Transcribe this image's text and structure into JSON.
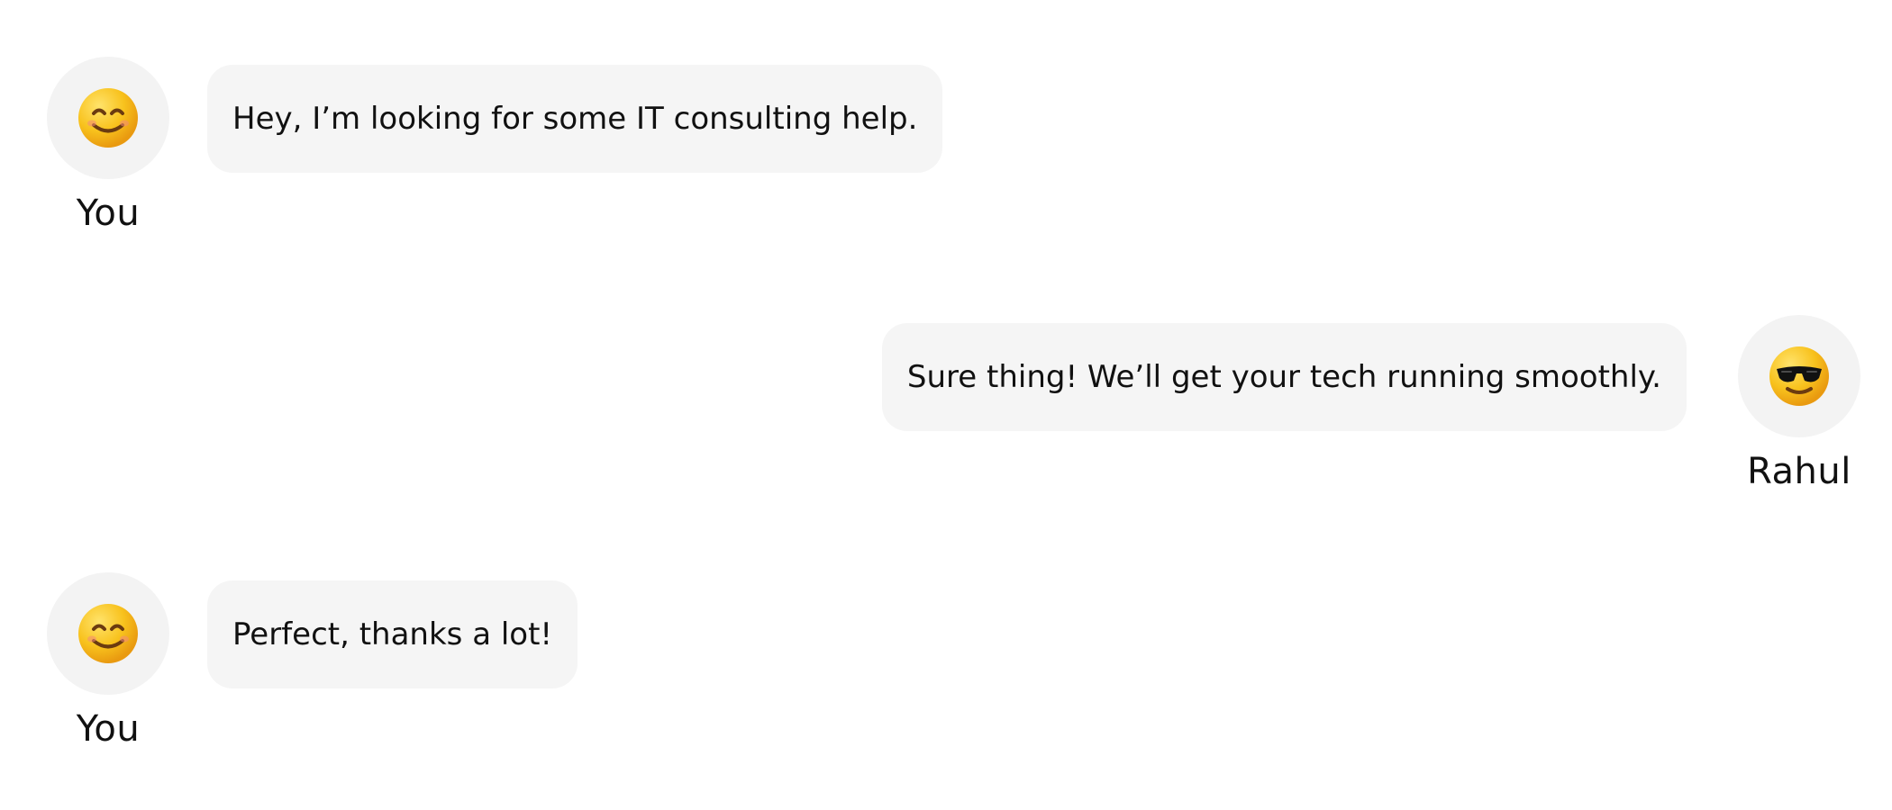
{
  "conversation": {
    "messages": [
      {
        "sender": "You",
        "avatar_icon": "smiling-face-icon",
        "text": "Hey, I’m looking for some IT consulting help."
      },
      {
        "sender": "Rahul",
        "avatar_icon": "sunglasses-face-icon",
        "text": "Sure thing! We’ll get your tech running smoothly."
      },
      {
        "sender": "You",
        "avatar_icon": "smiling-face-icon",
        "text": "Perfect, thanks a lot!"
      }
    ]
  },
  "colors": {
    "background": "#ffffff",
    "bubble": "#f5f5f5",
    "avatar_background": "#f3f3f3",
    "text": "#111111",
    "emoji_yellow": "#f8c21d"
  }
}
